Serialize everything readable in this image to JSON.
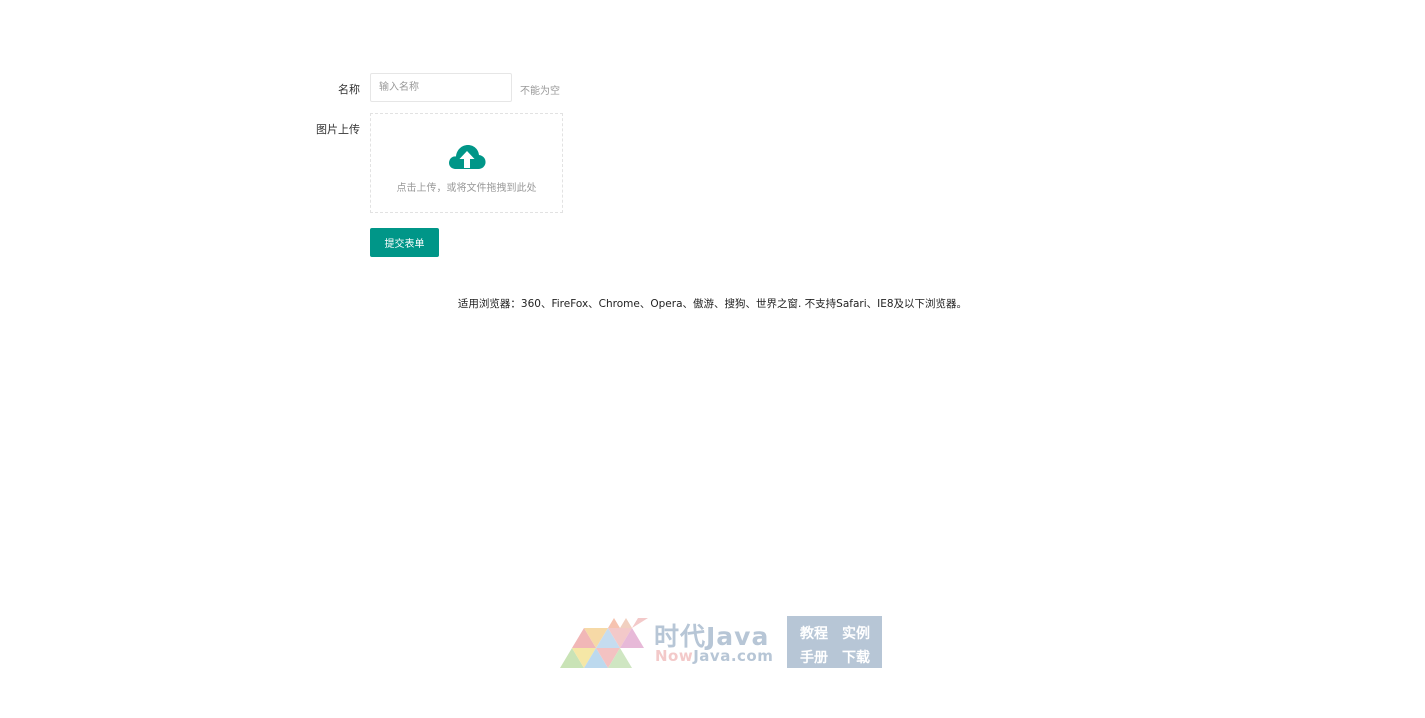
{
  "form": {
    "name_label": "名称",
    "name_placeholder": "输入名称",
    "name_hint": "不能为空",
    "upload_label": "图片上传",
    "upload_text": "点击上传，或将文件拖拽到此处",
    "upload_icon": "cloud-upload-icon",
    "submit_label": "提交表单"
  },
  "notice": "适用浏览器：360、FireFox、Chrome、Opera、傲游、搜狗、世界之窗. 不支持Safari、IE8及以下浏览器。",
  "logo": {
    "title": "时代Java",
    "domain_now": "Now",
    "domain_rest": "Java.com",
    "box_items": [
      "教程",
      "实例",
      "手册",
      "下载"
    ]
  },
  "colors": {
    "accent": "#009688",
    "logo_grey": "#b7c6d6",
    "logo_pink": "#f3c9c9"
  }
}
